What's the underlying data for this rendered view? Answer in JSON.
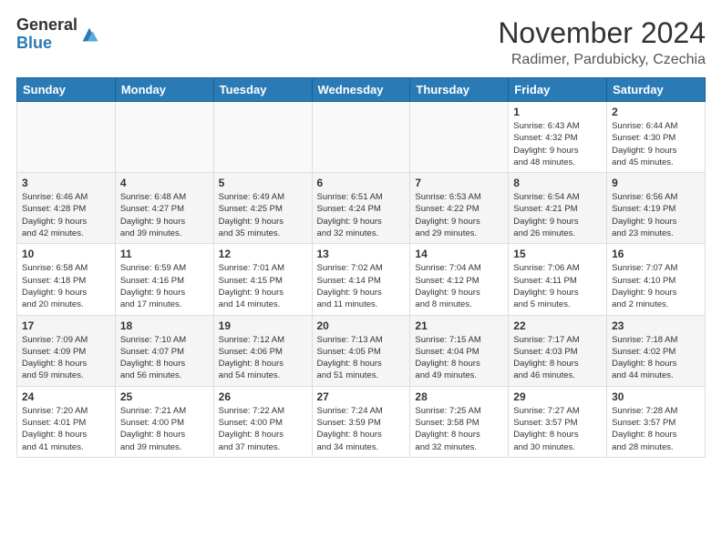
{
  "logo": {
    "general": "General",
    "blue": "Blue"
  },
  "title": "November 2024",
  "subtitle": "Radimer, Pardubicky, Czechia",
  "weekdays": [
    "Sunday",
    "Monday",
    "Tuesday",
    "Wednesday",
    "Thursday",
    "Friday",
    "Saturday"
  ],
  "weeks": [
    [
      {
        "day": "",
        "info": ""
      },
      {
        "day": "",
        "info": ""
      },
      {
        "day": "",
        "info": ""
      },
      {
        "day": "",
        "info": ""
      },
      {
        "day": "",
        "info": ""
      },
      {
        "day": "1",
        "info": "Sunrise: 6:43 AM\nSunset: 4:32 PM\nDaylight: 9 hours\nand 48 minutes."
      },
      {
        "day": "2",
        "info": "Sunrise: 6:44 AM\nSunset: 4:30 PM\nDaylight: 9 hours\nand 45 minutes."
      }
    ],
    [
      {
        "day": "3",
        "info": "Sunrise: 6:46 AM\nSunset: 4:28 PM\nDaylight: 9 hours\nand 42 minutes."
      },
      {
        "day": "4",
        "info": "Sunrise: 6:48 AM\nSunset: 4:27 PM\nDaylight: 9 hours\nand 39 minutes."
      },
      {
        "day": "5",
        "info": "Sunrise: 6:49 AM\nSunset: 4:25 PM\nDaylight: 9 hours\nand 35 minutes."
      },
      {
        "day": "6",
        "info": "Sunrise: 6:51 AM\nSunset: 4:24 PM\nDaylight: 9 hours\nand 32 minutes."
      },
      {
        "day": "7",
        "info": "Sunrise: 6:53 AM\nSunset: 4:22 PM\nDaylight: 9 hours\nand 29 minutes."
      },
      {
        "day": "8",
        "info": "Sunrise: 6:54 AM\nSunset: 4:21 PM\nDaylight: 9 hours\nand 26 minutes."
      },
      {
        "day": "9",
        "info": "Sunrise: 6:56 AM\nSunset: 4:19 PM\nDaylight: 9 hours\nand 23 minutes."
      }
    ],
    [
      {
        "day": "10",
        "info": "Sunrise: 6:58 AM\nSunset: 4:18 PM\nDaylight: 9 hours\nand 20 minutes."
      },
      {
        "day": "11",
        "info": "Sunrise: 6:59 AM\nSunset: 4:16 PM\nDaylight: 9 hours\nand 17 minutes."
      },
      {
        "day": "12",
        "info": "Sunrise: 7:01 AM\nSunset: 4:15 PM\nDaylight: 9 hours\nand 14 minutes."
      },
      {
        "day": "13",
        "info": "Sunrise: 7:02 AM\nSunset: 4:14 PM\nDaylight: 9 hours\nand 11 minutes."
      },
      {
        "day": "14",
        "info": "Sunrise: 7:04 AM\nSunset: 4:12 PM\nDaylight: 9 hours\nand 8 minutes."
      },
      {
        "day": "15",
        "info": "Sunrise: 7:06 AM\nSunset: 4:11 PM\nDaylight: 9 hours\nand 5 minutes."
      },
      {
        "day": "16",
        "info": "Sunrise: 7:07 AM\nSunset: 4:10 PM\nDaylight: 9 hours\nand 2 minutes."
      }
    ],
    [
      {
        "day": "17",
        "info": "Sunrise: 7:09 AM\nSunset: 4:09 PM\nDaylight: 8 hours\nand 59 minutes."
      },
      {
        "day": "18",
        "info": "Sunrise: 7:10 AM\nSunset: 4:07 PM\nDaylight: 8 hours\nand 56 minutes."
      },
      {
        "day": "19",
        "info": "Sunrise: 7:12 AM\nSunset: 4:06 PM\nDaylight: 8 hours\nand 54 minutes."
      },
      {
        "day": "20",
        "info": "Sunrise: 7:13 AM\nSunset: 4:05 PM\nDaylight: 8 hours\nand 51 minutes."
      },
      {
        "day": "21",
        "info": "Sunrise: 7:15 AM\nSunset: 4:04 PM\nDaylight: 8 hours\nand 49 minutes."
      },
      {
        "day": "22",
        "info": "Sunrise: 7:17 AM\nSunset: 4:03 PM\nDaylight: 8 hours\nand 46 minutes."
      },
      {
        "day": "23",
        "info": "Sunrise: 7:18 AM\nSunset: 4:02 PM\nDaylight: 8 hours\nand 44 minutes."
      }
    ],
    [
      {
        "day": "24",
        "info": "Sunrise: 7:20 AM\nSunset: 4:01 PM\nDaylight: 8 hours\nand 41 minutes."
      },
      {
        "day": "25",
        "info": "Sunrise: 7:21 AM\nSunset: 4:00 PM\nDaylight: 8 hours\nand 39 minutes."
      },
      {
        "day": "26",
        "info": "Sunrise: 7:22 AM\nSunset: 4:00 PM\nDaylight: 8 hours\nand 37 minutes."
      },
      {
        "day": "27",
        "info": "Sunrise: 7:24 AM\nSunset: 3:59 PM\nDaylight: 8 hours\nand 34 minutes."
      },
      {
        "day": "28",
        "info": "Sunrise: 7:25 AM\nSunset: 3:58 PM\nDaylight: 8 hours\nand 32 minutes."
      },
      {
        "day": "29",
        "info": "Sunrise: 7:27 AM\nSunset: 3:57 PM\nDaylight: 8 hours\nand 30 minutes."
      },
      {
        "day": "30",
        "info": "Sunrise: 7:28 AM\nSunset: 3:57 PM\nDaylight: 8 hours\nand 28 minutes."
      }
    ]
  ]
}
